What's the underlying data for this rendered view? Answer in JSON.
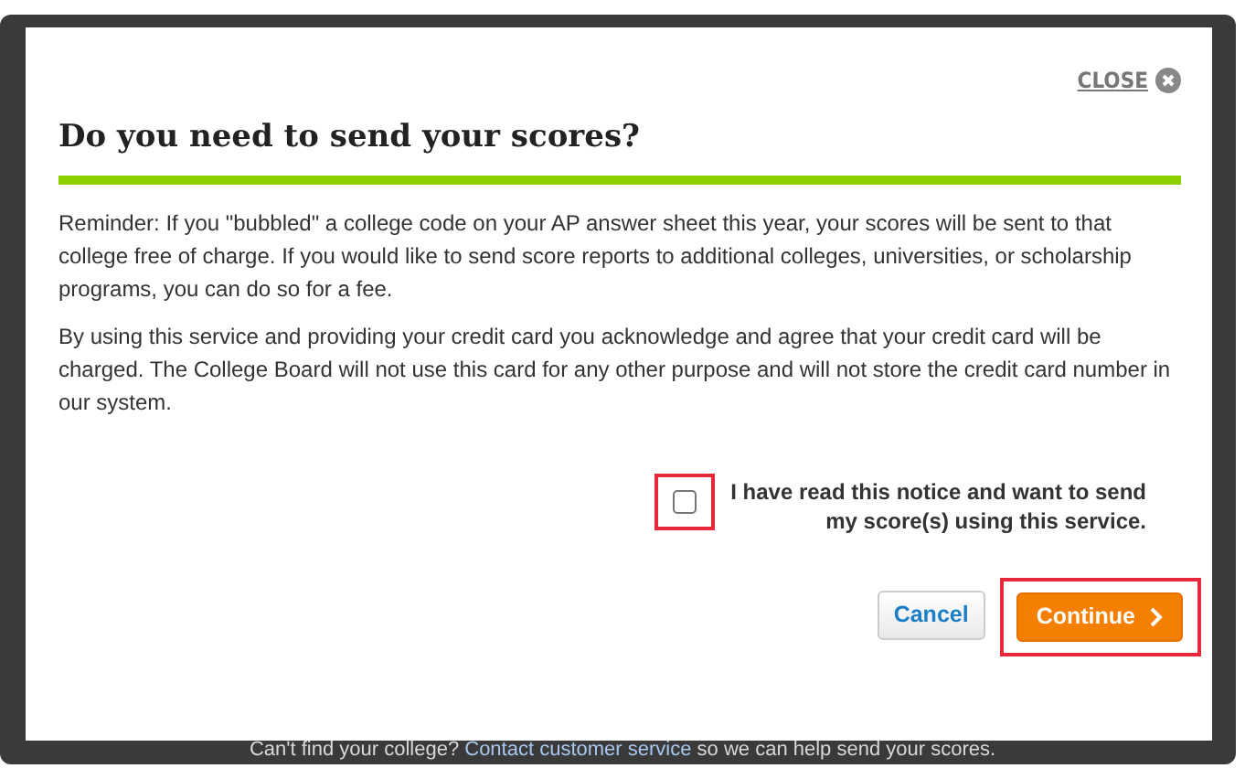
{
  "dialog": {
    "close_label": "CLOSE",
    "title": "Do you need to send your scores?",
    "paragraphs": [
      "Reminder: If you \"bubbled\" a college code on your AP answer sheet this year, your scores will be sent to that college free of charge. If you would like to send score reports to additional colleges, universities, or scholarship programs, you can do so for a fee.",
      "By using this service and providing your credit card you acknowledge and agree that your credit card will be charged. The College Board will not use this card for any other purpose and will not store the credit card number in our system."
    ],
    "agreement": {
      "label": "I have read this notice and want to send my score(s) using this service.",
      "checked": false,
      "highlighted": true
    },
    "buttons": [
      {
        "label": "Cancel",
        "kind": "secondary",
        "highlighted": false
      },
      {
        "label": "Continue",
        "kind": "primary",
        "highlighted": true
      }
    ]
  },
  "background": {
    "help_text": "Can't find your college?",
    "help_link": "Contact customer service",
    "help_suffix": "so we can help send your scores."
  }
}
